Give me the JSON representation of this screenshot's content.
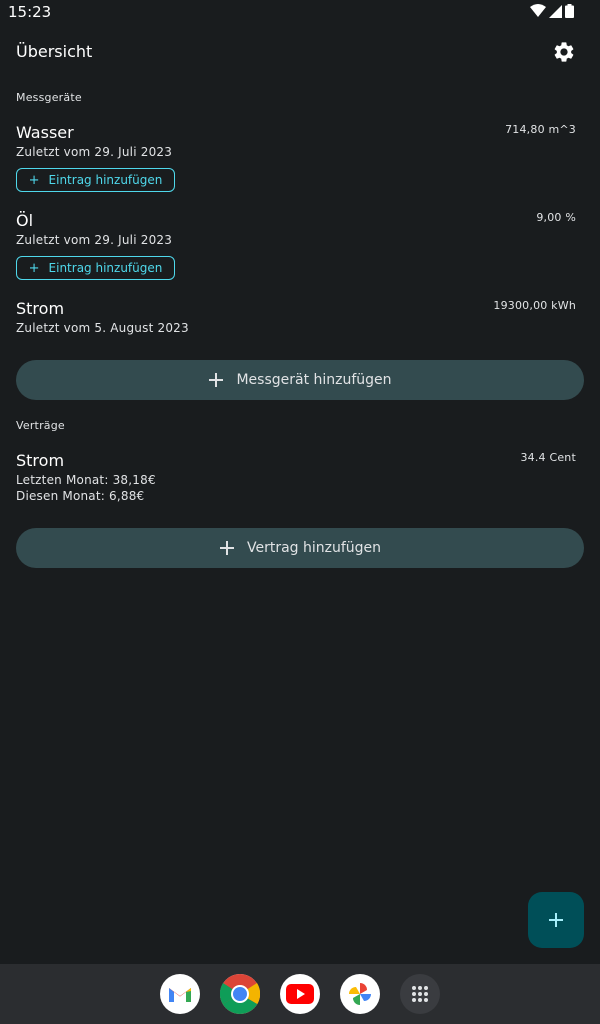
{
  "status_bar": {
    "time": "15:23"
  },
  "app_bar": {
    "title": "Übersicht"
  },
  "meters": {
    "header": "Messgeräte",
    "items": [
      {
        "name": "Wasser",
        "last_entry": "Zuletzt vom 29. Juli 2023",
        "value": "714,80 m^3",
        "add_entry_label": "Eintrag hinzufügen"
      },
      {
        "name": "Öl",
        "last_entry": "Zuletzt vom 29. Juli 2023",
        "value": "9,00 %",
        "add_entry_label": "Eintrag hinzufügen"
      },
      {
        "name": "Strom",
        "last_entry": "Zuletzt vom 5. August 2023",
        "value": "19300,00 kWh"
      }
    ],
    "add_button_label": "Messgerät hinzufügen"
  },
  "contracts": {
    "header": "Verträge",
    "items": [
      {
        "name": "Strom",
        "last_month": "Letzten Monat: 38,18€",
        "this_month": "Diesen Monat: 6,88€",
        "price": "34.4 Cent"
      }
    ],
    "add_button_label": "Vertrag hinzufügen"
  },
  "fab": {
    "icon": "plus-icon"
  },
  "dock": {
    "apps": [
      {
        "name": "Gmail",
        "icon": "gmail-icon"
      },
      {
        "name": "Chrome",
        "icon": "chrome-icon"
      },
      {
        "name": "YouTube",
        "icon": "youtube-icon"
      },
      {
        "name": "Photos",
        "icon": "photos-icon"
      },
      {
        "name": "App drawer",
        "icon": "app-drawer-icon"
      }
    ]
  },
  "colors": {
    "background": "#191c1e",
    "accent": "#4fd8eb",
    "tonal_button": "#334b4f",
    "fab": "#004f58"
  }
}
